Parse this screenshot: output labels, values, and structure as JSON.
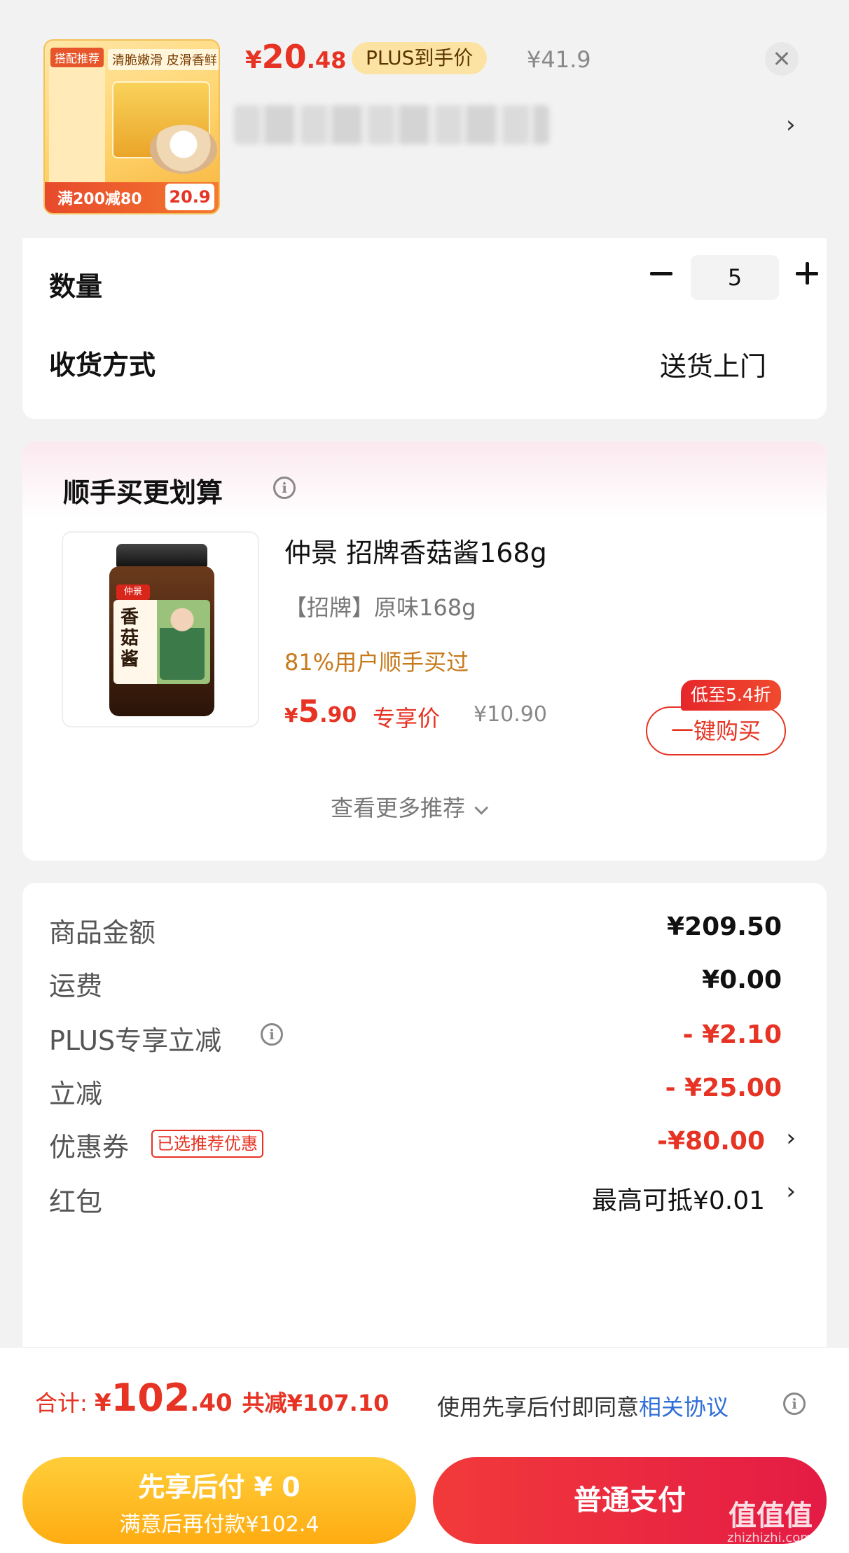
{
  "product": {
    "thumb_tag": "搭配推荐",
    "thumb_slogan": "清脆嫩滑 皮滑香鲜",
    "thumb_promo": "满200减80",
    "thumb_promo_price": "20.9",
    "price_symbol": "¥",
    "price_int": "20",
    "price_dec": ".48",
    "plus_badge": "PLUS到手价",
    "original_price": "¥41.9",
    "spec_chevron": "›"
  },
  "order": {
    "quantity_label": "数量",
    "quantity_value": "5",
    "delivery_label": "收货方式",
    "delivery_value": "送货上门"
  },
  "recommend": {
    "title": "顺手买更划算",
    "jar_brand": "仲景",
    "jar_name": "香菇酱",
    "item_name": "仲景 招牌香菇酱168g",
    "variant": "【招牌】原味168g",
    "social_proof": "81%用户顺手买过",
    "price_symbol": "¥",
    "price_int": "5",
    "price_dec": ".90",
    "exclusive_label": "专享价",
    "original_price": "¥10.90",
    "discount_tag": "低至5.4折",
    "buy_button": "一键购买",
    "more": "查看更多推荐"
  },
  "summary": {
    "rows": [
      {
        "label": "商品金额",
        "value": "¥209.50"
      },
      {
        "label": "运费",
        "value": "¥0.00"
      },
      {
        "label": "PLUS专享立减",
        "value": "- ¥2.10"
      },
      {
        "label": "立减",
        "value": "- ¥25.00"
      },
      {
        "label": "优惠券",
        "value": "-¥80.00",
        "tag": "已选推荐优惠"
      },
      {
        "label": "红包",
        "value": "最高可抵¥0.01"
      }
    ],
    "chevron": "›"
  },
  "footer": {
    "total_label": "合计: ",
    "total_symbol": "¥",
    "total_int": "102",
    "total_dec": ".40",
    "saved": "共减¥107.10",
    "agree_text": "使用先享后付即同意",
    "agree_link": "相关协议",
    "bnpl_title": "先享后付 ¥ 0",
    "bnpl_sub": "满意后再付款¥102.4",
    "pay_button": "普通支付"
  },
  "watermark": {
    "text": "值值值",
    "sub": "zhizhizhi.com"
  },
  "colors": {
    "accent_red": "#e63323",
    "plus_gold": "#fde3a3",
    "bnpl_yellow": "#ffac12",
    "link_blue": "#2f6fd6"
  },
  "icons": [
    "close-icon",
    "chevron-right-icon",
    "minus-icon",
    "plus-icon",
    "info-icon",
    "chevron-down-icon"
  ]
}
